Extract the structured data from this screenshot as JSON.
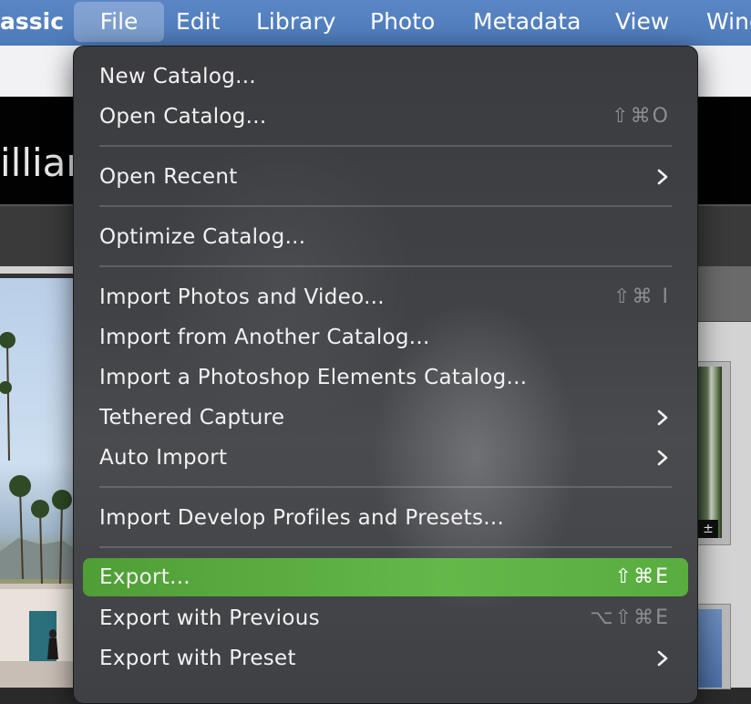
{
  "menubar": {
    "items": [
      {
        "label": "assic"
      },
      {
        "label": "File"
      },
      {
        "label": "Edit"
      },
      {
        "label": "Library"
      },
      {
        "label": "Photo"
      },
      {
        "label": "Metadata"
      },
      {
        "label": "View"
      },
      {
        "label": "Wind"
      }
    ]
  },
  "background": {
    "identity_plate_text": "illiar",
    "thumb_badge": "±"
  },
  "file_menu": {
    "items": [
      {
        "label": "New Catalog...",
        "shortcut": ""
      },
      {
        "label": "Open Catalog...",
        "shortcut": "⇧⌘O"
      },
      {
        "label": "Open Recent",
        "submenu": true
      },
      {
        "label": "Optimize Catalog..."
      },
      {
        "label": "Import Photos and Video...",
        "shortcut": "⇧⌘ I"
      },
      {
        "label": "Import from Another Catalog..."
      },
      {
        "label": "Import a Photoshop Elements Catalog..."
      },
      {
        "label": "Tethered Capture",
        "submenu": true
      },
      {
        "label": "Auto Import",
        "submenu": true
      },
      {
        "label": "Import Develop Profiles and Presets..."
      },
      {
        "label": "Export...",
        "shortcut": "⇧⌘E",
        "highlighted": true
      },
      {
        "label": "Export with Previous",
        "shortcut": "⌥⇧⌘E"
      },
      {
        "label": "Export with Preset",
        "submenu": true
      }
    ]
  },
  "colors": {
    "menubar": "#4d7ab9",
    "highlight": "#5fb244",
    "menu_bg": "#404246",
    "shortcut_text": "#8d8e92"
  }
}
